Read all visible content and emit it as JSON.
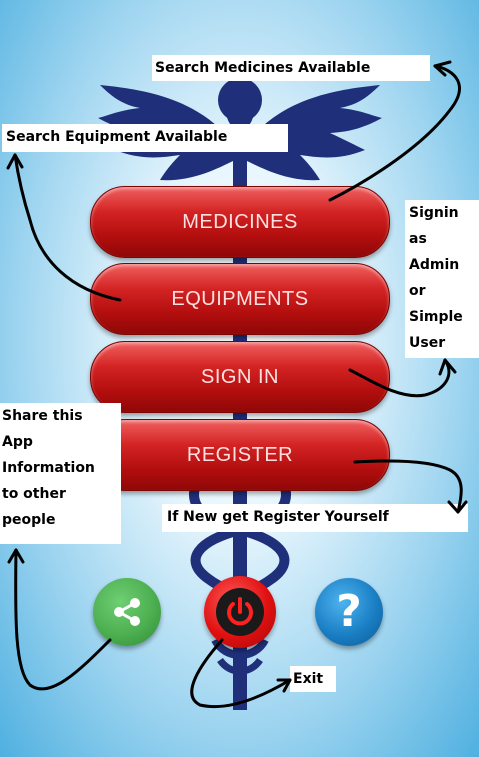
{
  "buttons": {
    "medicines": "MEDICINES",
    "equipments": "EQUIPMENTS",
    "sign_in": "SIGN IN",
    "register": "REGISTER"
  },
  "annotations": {
    "search_medicines": "Search Medicines Available",
    "search_equipment": "Search Equipment Available",
    "signin_role": "Signin\nas\nAdmin\nor\nSimple\nUser",
    "share_info": "Share this\nApp\nInformation\nto other\npeople",
    "register_hint": "If New get Register Yourself",
    "exit": "Exit"
  },
  "icons": {
    "share": "share-icon",
    "power": "power-icon",
    "help": "question-mark-icon"
  },
  "colors": {
    "button_red": "#c41414",
    "share_green": "#4caf50",
    "power_red": "#e01010",
    "help_blue": "#1a7fc4",
    "emblem_navy": "#1f2f7a"
  }
}
